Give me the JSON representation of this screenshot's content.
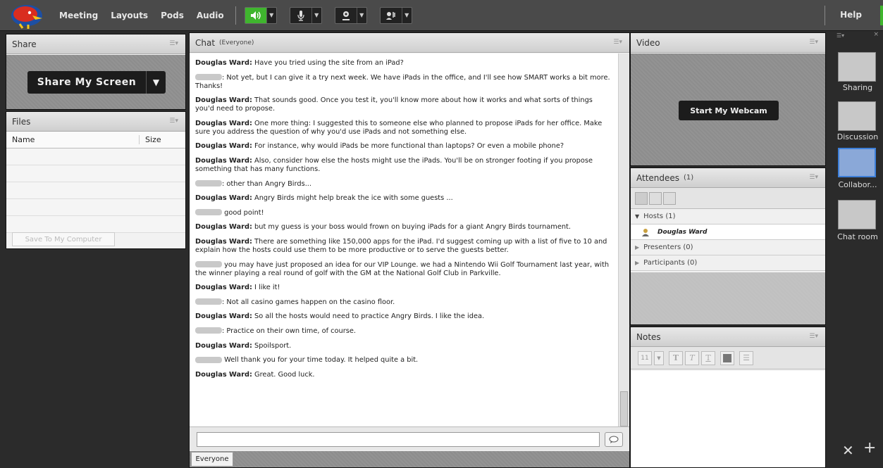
{
  "menu": [
    "Meeting",
    "Layouts",
    "Pods",
    "Audio"
  ],
  "help_label": "Help",
  "share": {
    "title": "Share",
    "button": "Share My Screen"
  },
  "files": {
    "title": "Files",
    "col_name": "Name",
    "col_size": "Size",
    "save_button": "Save To My Computer"
  },
  "chat": {
    "title": "Chat",
    "scope": "(Everyone)",
    "tab": "Everyone",
    "messages": [
      {
        "who": "Douglas Ward:",
        "text": " Have you tried using the site from an iPad?"
      },
      {
        "who": "",
        "text": ": Not yet, but I can give it a try next week. We have iPads in the office, and I'll see how SMART works a bit more. Thanks!"
      },
      {
        "who": "Douglas Ward:",
        "text": " That sounds good. Once you test it, you'll know more about how it works and what sorts of things you'd need to propose."
      },
      {
        "who": "Douglas Ward:",
        "text": " One more thing: I suggested this to someone else who planned to propose iPads for her office. Make sure you address the question of why you'd use iPads and not something else."
      },
      {
        "who": "Douglas Ward:",
        "text": " For instance, why would iPads be more functional than laptops? Or even a mobile phone?"
      },
      {
        "who": "Douglas Ward:",
        "text": " Also, consider how else the hosts might use the iPads. You'll be on stronger footing if you propose something that has many functions."
      },
      {
        "who": "",
        "text": ": other than Angry Birds..."
      },
      {
        "who": "Douglas Ward:",
        "text": " Angry Birds might help break the ice with some guests ..."
      },
      {
        "who": "",
        "text": " good point!"
      },
      {
        "who": "Douglas Ward:",
        "text": " but my guess is your boss would frown on buying iPads for a giant Angry Birds tournament."
      },
      {
        "who": "Douglas Ward:",
        "text": " There are something like 150,000 apps for the iPad. I'd suggest coming up with a list of five to 10 and explain how the hosts could use them to be more productive or to serve the guests better."
      },
      {
        "who": "",
        "text": " you may have just proposed an idea for our VIP Lounge. we had a Nintendo Wii Golf Tournament last year, with the winner playing a real round of golf with the GM at the National Golf Club in Parkville."
      },
      {
        "who": "Douglas Ward:",
        "text": " I like it!"
      },
      {
        "who": "",
        "text": ": Not all casino games happen on the casino floor."
      },
      {
        "who": "Douglas Ward:",
        "text": " So all the hosts would need to practice Angry Birds. I like the idea."
      },
      {
        "who": "",
        "text": ": Practice on their own time, of course."
      },
      {
        "who": "Douglas Ward:",
        "text": " Spoilsport."
      },
      {
        "who": "",
        "text": " Well thank you for your time today. It helped quite a bit."
      },
      {
        "who": "Douglas Ward:",
        "text": " Great. Good luck."
      }
    ]
  },
  "video": {
    "title": "Video",
    "button": "Start My Webcam"
  },
  "attendees": {
    "title": "Attendees",
    "count": "(1)",
    "hosts": "Hosts (1)",
    "host_name": "Douglas Ward",
    "presenters": "Presenters (0)",
    "participants": "Participants (0)"
  },
  "notes": {
    "title": "Notes",
    "font_size": "11"
  },
  "layouts": [
    "Sharing",
    "Discussion",
    "Collabor...",
    "Chat room"
  ]
}
